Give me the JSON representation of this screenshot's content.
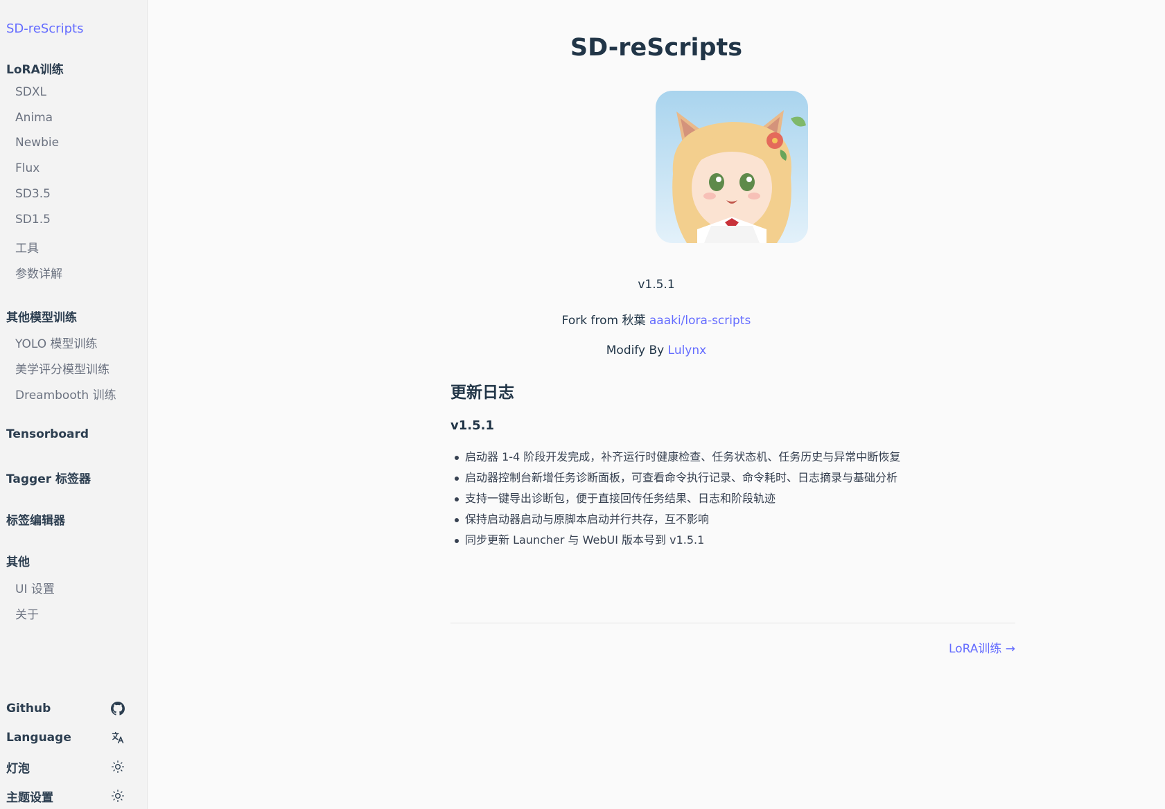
{
  "sidebar": {
    "brand": "SD-reScripts",
    "groups": [
      {
        "title": "LoRA训练",
        "items": [
          "SDXL",
          "Anima",
          "Newbie",
          "Flux",
          "SD3.5",
          "SD1.5",
          "工具",
          "参数详解"
        ]
      },
      {
        "title": "其他模型训练",
        "items": [
          "YOLO 模型训练",
          "美学评分模型训练",
          "Dreambooth 训练"
        ]
      },
      {
        "title": "Tensorboard",
        "items": []
      },
      {
        "title": "Tagger 标签器",
        "items": []
      },
      {
        "title": "标签编辑器",
        "items": []
      },
      {
        "title": "其他",
        "items": [
          "UI 设置",
          "关于"
        ]
      }
    ],
    "bottom": [
      {
        "label": "Github",
        "icon": "github-icon"
      },
      {
        "label": "Language",
        "icon": "translate-icon"
      },
      {
        "label": "灯泡",
        "icon": "sun-icon"
      },
      {
        "label": "主题设置",
        "icon": "sun-icon"
      }
    ]
  },
  "main": {
    "title": "SD-reScripts",
    "version": "v1.5.1",
    "fork_prefix": "Fork from 秋葉 ",
    "fork_link": "aaaki/lora-scripts",
    "modify_prefix": "Modify By ",
    "modify_link": "Lulynx",
    "changelog_heading": "更新日志",
    "changelog_version": "v1.5.1",
    "changes": [
      "启动器 1-4 阶段开发完成，补齐运行时健康检查、任务状态机、任务历史与异常中断恢复",
      "启动器控制台新增任务诊断面板，可查看命令执行记录、命令耗时、日志摘录与基础分析",
      "支持一键导出诊断包，便于直接回传任务结果、日志和阶段轨迹",
      "保持启动器启动与原脚本启动并行共存，互不影响",
      "同步更新 Launcher 与 WebUI 版本号到 v1.5.1"
    ],
    "next_link": "LoRA训练 →"
  },
  "colors": {
    "accent": "#646cff",
    "text": "#2c3e50",
    "sidebar_bg": "#f3f3f3",
    "page_bg": "#fafafa"
  }
}
